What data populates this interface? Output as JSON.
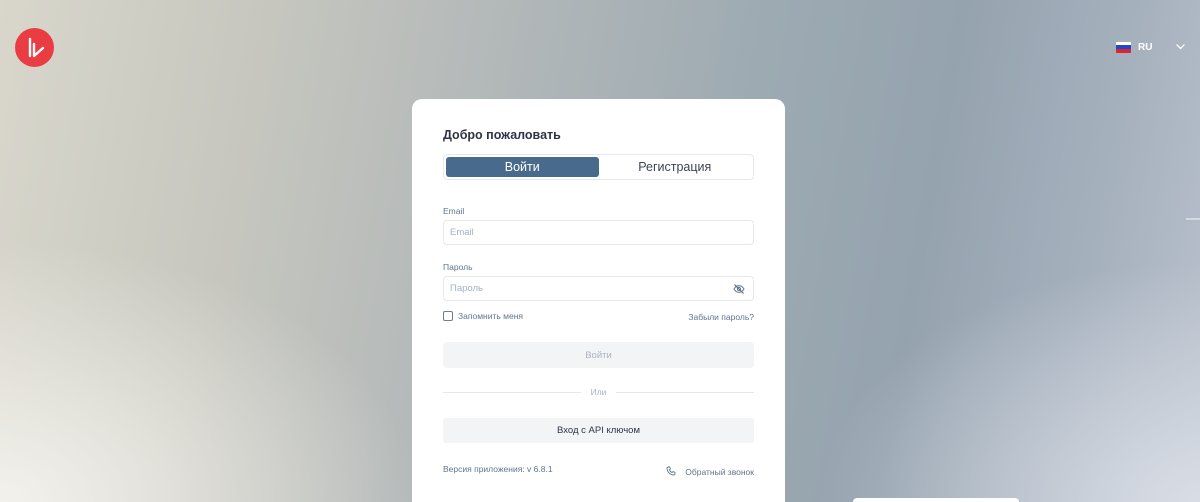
{
  "header": {
    "logo_icon": "brand-logo-icon",
    "language": {
      "code": "RU",
      "flag_icon": "russian-flag-icon",
      "chevron_icon": "chevron-down-icon"
    }
  },
  "card": {
    "title": "Добро пожаловать",
    "tabs": [
      {
        "label": "Войти",
        "active": true
      },
      {
        "label": "Регистрация",
        "active": false
      }
    ],
    "email": {
      "label": "Email",
      "placeholder": "Email",
      "value": ""
    },
    "password": {
      "label": "Пароль",
      "placeholder": "Пароль",
      "value": "",
      "toggle_icon": "eye-off-icon"
    },
    "remember_label": "Запомнить меня",
    "remember_checked": false,
    "forgot_label": "Забыли пароль?",
    "submit_label": "Войти",
    "divider_label": "Или",
    "api_label": "Вход с API ключом",
    "version_text": "Версия приложения: v 6.8.1",
    "callback": {
      "label": "Обратный звонок",
      "icon": "phone-icon"
    }
  },
  "colors": {
    "brand": "#ea3d43",
    "active_tab": "#486a8c",
    "label": "#5e7590",
    "title": "#2c3446"
  }
}
